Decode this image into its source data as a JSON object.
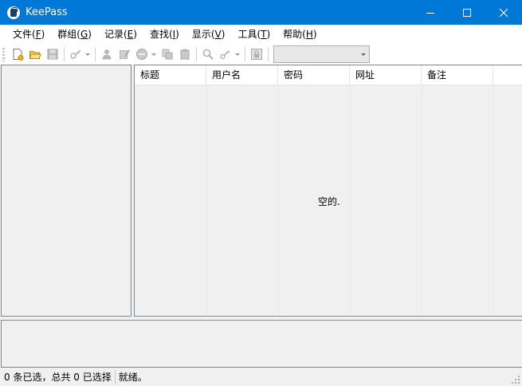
{
  "window": {
    "title": "KeePass",
    "controls": {
      "minimize": "minimize-icon",
      "maximize": "maximize-icon",
      "close": "close-icon"
    }
  },
  "menu": [
    {
      "label": "文件(",
      "acc": "F",
      "end": ")"
    },
    {
      "label": "群组(",
      "acc": "G",
      "end": ")"
    },
    {
      "label": "记录(",
      "acc": "E",
      "end": ")"
    },
    {
      "label": "查找(",
      "acc": "I",
      "end": ")"
    },
    {
      "label": "显示(",
      "acc": "V",
      "end": ")"
    },
    {
      "label": "工具(",
      "acc": "T",
      "end": ")"
    },
    {
      "label": "帮助(",
      "acc": "H",
      "end": ")"
    }
  ],
  "toolbar": {
    "icons": [
      "new-database-icon",
      "open-database-icon",
      "save-icon",
      "copy-username-icon",
      "add-entry-icon",
      "edit-entry-icon",
      "delete-entry-icon",
      "copy-entry-icon",
      "paste-entry-icon",
      "find-icon",
      "show-entries-icon",
      "lock-icon"
    ],
    "quick_find_value": ""
  },
  "entry_list": {
    "columns": [
      "标题",
      "用户名",
      "密码",
      "网址",
      "备注"
    ],
    "empty_text": "空的."
  },
  "status": {
    "selection": "0 条已选，总共 0 已选择",
    "state": "就绪。"
  },
  "colors": {
    "titlebar": "#0078d7",
    "background": "#f0f0f0"
  }
}
